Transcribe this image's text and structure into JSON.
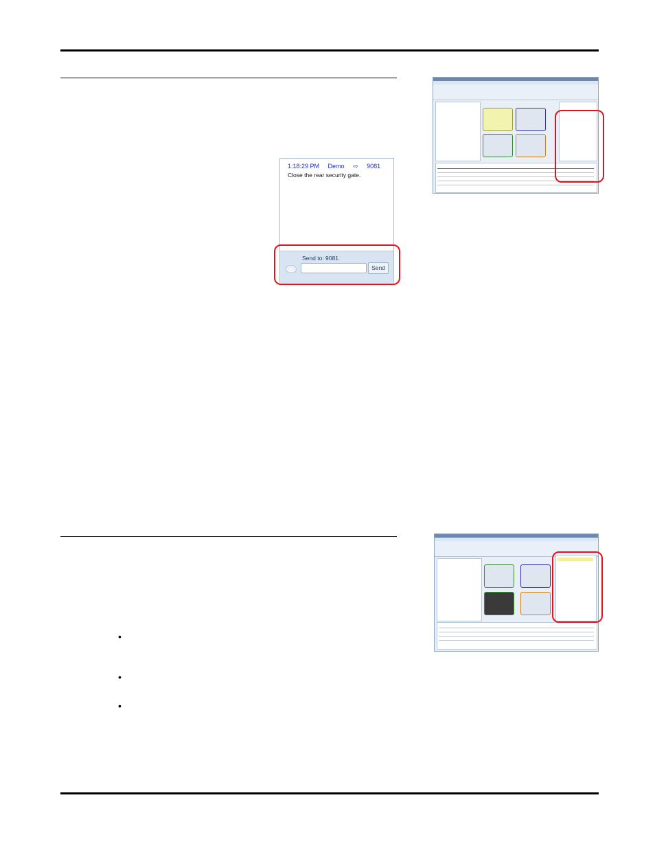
{
  "message_panel": {
    "time": "1:18:29 PM",
    "from": "Demo",
    "arrow": "⇨",
    "to": "9081",
    "message": "Close the rear security gate.",
    "send_to_label": "Send to: 9081",
    "send_button": "Send",
    "input_value": ""
  },
  "bullets": [
    "•",
    "•",
    "•"
  ],
  "colors": {
    "highlight": "#e0141e",
    "header_text": "#1b2fc8",
    "panel_bar": "#d8e4f1"
  }
}
